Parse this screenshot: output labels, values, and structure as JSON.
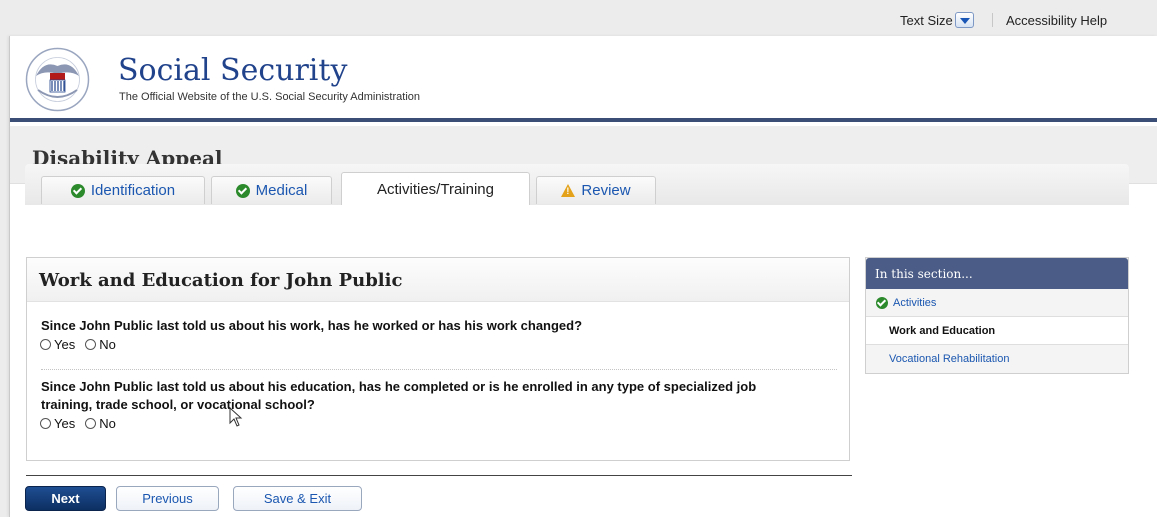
{
  "utility": {
    "text_size_label": "Text Size",
    "accessibility_label": "Accessibility Help"
  },
  "header": {
    "site_title": "Social Security",
    "tagline": "The Official Website of the U.S. Social Security Administration",
    "seal_text": "SOCIAL SECURITY ADMINISTRATION USA"
  },
  "app": {
    "title": "Disability Appeal"
  },
  "tabs": [
    {
      "label": "Identification",
      "status": "complete"
    },
    {
      "label": "Medical",
      "status": "complete"
    },
    {
      "label": "Activities/Training",
      "status": "active"
    },
    {
      "label": "Review",
      "status": "warning"
    }
  ],
  "form": {
    "title": "Work and Education for John Public",
    "questions": [
      {
        "text": "Since John Public last told us about his work, has he worked or has his work changed?",
        "options": [
          "Yes",
          "No"
        ],
        "selected": null
      },
      {
        "text": "Since John Public last told us about his education, has he completed or is he enrolled in any type of specialized job training, trade school, or vocational school?",
        "options": [
          "Yes",
          "No"
        ],
        "selected": null
      }
    ]
  },
  "buttons": {
    "next": "Next",
    "previous": "Previous",
    "save_exit": "Save & Exit"
  },
  "sidebar": {
    "title": "In this section...",
    "items": [
      {
        "label": "Activities",
        "state": "complete"
      },
      {
        "label": "Work and Education",
        "state": "current"
      },
      {
        "label": "Vocational Rehabilitation",
        "state": "pending"
      }
    ]
  },
  "colors": {
    "brand_navy": "#21438c",
    "header_rule": "#3b4e75",
    "link_blue": "#1b57b0",
    "primary_button": "#163f7a",
    "success_green": "#2c8a2c",
    "warning_amber": "#e3a21a"
  }
}
